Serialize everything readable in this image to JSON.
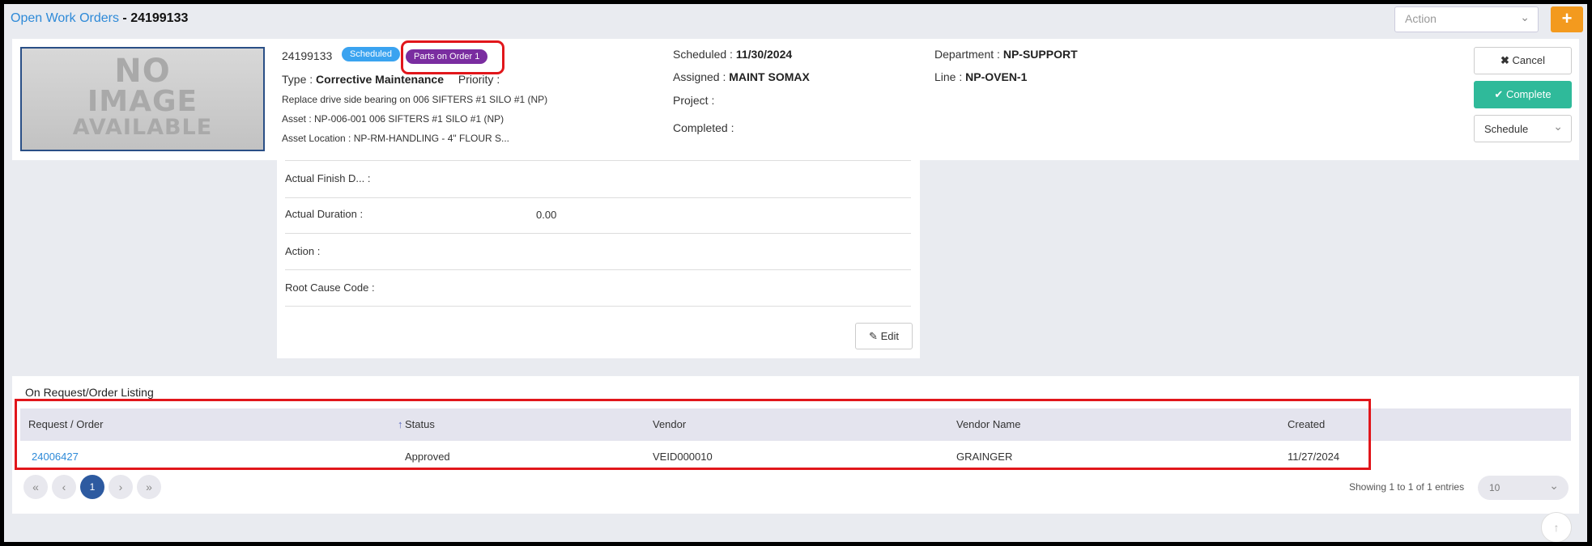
{
  "header": {
    "breadcrumb_link": "Open Work Orders",
    "separator": " - ",
    "work_order_id": "24199133",
    "action_placeholder": "Action",
    "add_label": "+"
  },
  "no_image": [
    "NO",
    "IMAGE",
    "AVAILABLE"
  ],
  "summary": {
    "id": "24199133",
    "status_badge": "Scheduled",
    "parts_badge": "Parts on Order 1",
    "type_label": "Type :",
    "type_value": "Corrective Maintenance",
    "priority_label": "Priority :",
    "description": "Replace drive side bearing on 006 SIFTERS #1 SILO #1 (NP)",
    "asset": "Asset : NP-006-001 006 SIFTERS #1 SILO #1 (NP)",
    "asset_location": "Asset Location : NP-RM-HANDLING - 4\" FLOUR S...",
    "scheduled_label": "Scheduled :",
    "scheduled_value": "11/30/2024",
    "assigned_label": "Assigned :",
    "assigned_value": "MAINT SOMAX",
    "project_label": "Project :",
    "completed_label": "Completed :",
    "department_label": "Department :",
    "department_value": "NP-SUPPORT",
    "line_label": "Line :",
    "line_value": "NP-OVEN-1"
  },
  "buttons": {
    "cancel": "Cancel",
    "complete": "Complete",
    "schedule": "Schedule",
    "edit": "Edit"
  },
  "details": {
    "actual_finish_label": "Actual Finish D... :",
    "actual_duration_label": "Actual Duration :",
    "actual_duration_value": "0.00",
    "action_label": "Action :",
    "root_cause_label": "Root Cause Code :"
  },
  "listing": {
    "title": "On Request/Order Listing",
    "columns": [
      "Request / Order",
      "Status",
      "Vendor",
      "Vendor Name",
      "Created"
    ],
    "rows": [
      {
        "order": "24006427",
        "status": "Approved",
        "vendor": "VEID000010",
        "vendor_name": "GRAINGER",
        "created": "11/27/2024"
      }
    ],
    "current_page": "1",
    "showing": "Showing 1 to 1 of 1 entries",
    "page_size": "10"
  },
  "colors": {
    "brand_link": "#2e8ad8",
    "scheduled_badge": "#3aa3f0",
    "parts_badge": "#7a2da0",
    "complete_button": "#2fba9a",
    "add_button": "#f39a1e",
    "highlight": "#e1161b"
  },
  "icons": {
    "cancel": "times-icon",
    "complete": "check-icon",
    "edit": "pencil-icon",
    "sort": "arrow-up-icon",
    "scroll_top": "arrow-up-icon"
  }
}
